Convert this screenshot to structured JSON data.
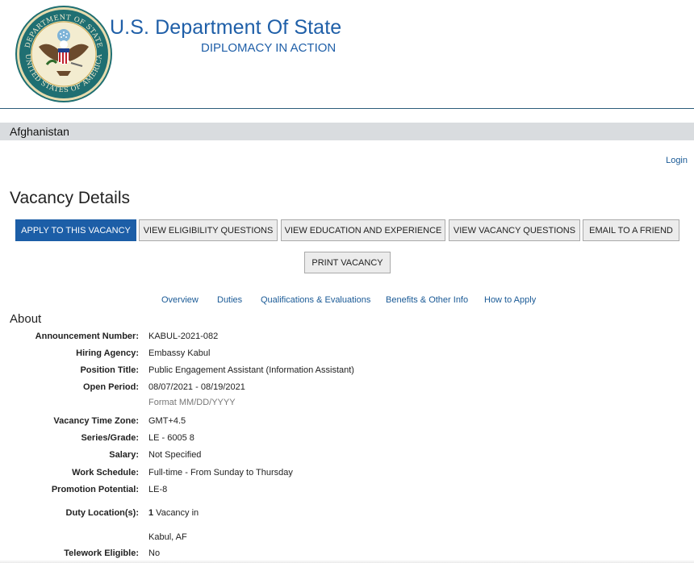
{
  "header": {
    "seal_text_top": "DEPARTMENT OF STATE",
    "seal_text_bottom": "UNITED STATES OF AMERICA",
    "title": "U.S. Department Of State",
    "subtitle": "DIPLOMACY IN ACTION"
  },
  "country": "Afghanistan",
  "login_label": "Login",
  "page_title": "Vacancy Details",
  "buttons": {
    "apply": "APPLY TO THIS VACANCY",
    "eligibility": "VIEW ELIGIBILITY QUESTIONS",
    "education": "VIEW EDUCATION AND EXPERIENCE",
    "vacancy_questions": "VIEW VACANCY QUESTIONS",
    "email": "EMAIL TO A FRIEND",
    "print": "PRINT VACANCY"
  },
  "tabs": [
    "Overview",
    "Duties",
    "Qualifications & Evaluations",
    "Benefits & Other Info",
    "How to Apply"
  ],
  "about": {
    "heading": "About",
    "fields": [
      {
        "label": "Announcement Number:",
        "value": "KABUL-2021-082"
      },
      {
        "label": "Hiring Agency:",
        "value": "Embassy Kabul"
      },
      {
        "label": "Position Title:",
        "value": "Public Engagement Assistant (Information Assistant)"
      },
      {
        "label": "Open Period:",
        "value": "08/07/2021 - 08/19/2021",
        "hint": "Format MM/DD/YYYY"
      },
      {
        "label": "Vacancy Time Zone:",
        "value": "GMT+4.5"
      },
      {
        "label": "Series/Grade:",
        "value": "LE - 6005 8"
      },
      {
        "label": "Salary:",
        "value": "Not Specified"
      },
      {
        "label": "Work Schedule:",
        "value": "Full-time - From Sunday to Thursday"
      },
      {
        "label": "Promotion Potential:",
        "value": "LE-8"
      },
      {
        "label": "Duty Location(s):",
        "value_count": "1",
        "value_text": " Vacancy in",
        "location": "Kabul, AF"
      },
      {
        "label": "Telework Eligible:",
        "value": "No"
      }
    ]
  }
}
